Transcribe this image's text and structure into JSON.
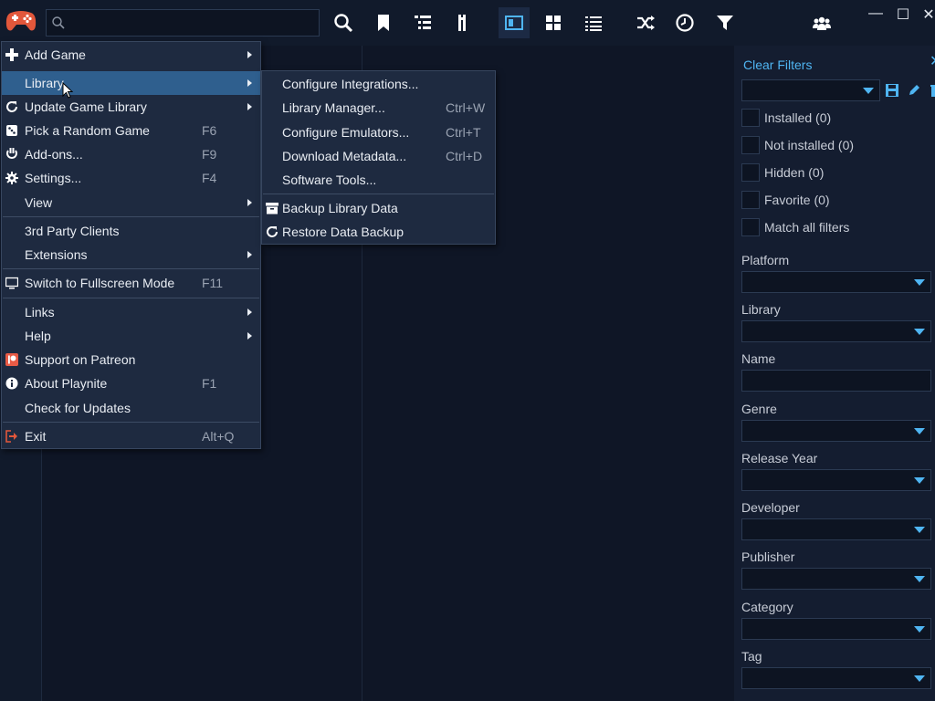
{
  "search": {
    "placeholder": ""
  },
  "toolbar": {
    "icons": [
      "search-icon",
      "bookmark-icon",
      "list-tree-icon",
      "columns-icon",
      "details-view-icon",
      "grid-view-icon",
      "list-view-icon",
      "shuffle-icon",
      "clock-icon",
      "filter-icon",
      "group-icon"
    ],
    "accent": "#4fb5f2"
  },
  "window": {
    "minimize": "—",
    "maximize": "☐",
    "close": "✕"
  },
  "main_menu": {
    "items": [
      {
        "label": "Add Game",
        "shortcut": "",
        "submenu": true,
        "icon": "plus-icon"
      },
      {
        "label": "Library",
        "shortcut": "",
        "submenu": true,
        "icon": ""
      },
      {
        "label": "Update Game Library",
        "shortcut": "",
        "submenu": true,
        "icon": "refresh-icon"
      },
      {
        "label": "Pick a Random Game",
        "shortcut": "F6",
        "submenu": false,
        "icon": "dice-icon"
      },
      {
        "label": "Add-ons...",
        "shortcut": "F9",
        "submenu": false,
        "icon": "plug-icon"
      },
      {
        "label": "Settings...",
        "shortcut": "F4",
        "submenu": false,
        "icon": "gear-icon"
      },
      {
        "label": "View",
        "shortcut": "",
        "submenu": true,
        "icon": ""
      },
      {
        "label": "3rd Party Clients",
        "shortcut": "",
        "submenu": false,
        "icon": ""
      },
      {
        "label": "Extensions",
        "shortcut": "",
        "submenu": true,
        "icon": ""
      },
      {
        "label": "Switch to Fullscreen Mode",
        "shortcut": "F11",
        "submenu": false,
        "icon": "monitor-icon"
      },
      {
        "label": "Links",
        "shortcut": "",
        "submenu": true,
        "icon": ""
      },
      {
        "label": "Help",
        "shortcut": "",
        "submenu": true,
        "icon": ""
      },
      {
        "label": "Support on Patreon",
        "shortcut": "",
        "submenu": false,
        "icon": "patreon-icon"
      },
      {
        "label": "About Playnite",
        "shortcut": "F1",
        "submenu": false,
        "icon": "info-icon"
      },
      {
        "label": "Check for Updates",
        "shortcut": "",
        "submenu": false,
        "icon": ""
      },
      {
        "label": "Exit",
        "shortcut": "Alt+Q",
        "submenu": false,
        "icon": "exit-icon"
      }
    ]
  },
  "library_menu": {
    "items": [
      {
        "label": "Configure Integrations...",
        "shortcut": ""
      },
      {
        "label": "Library Manager...",
        "shortcut": "Ctrl+W"
      },
      {
        "label": "Configure Emulators...",
        "shortcut": "Ctrl+T"
      },
      {
        "label": "Download Metadata...",
        "shortcut": "Ctrl+D"
      },
      {
        "label": "Software Tools...",
        "shortcut": ""
      },
      {
        "label": "Backup Library Data",
        "shortcut": "",
        "icon": "archive-icon"
      },
      {
        "label": "Restore Data Backup",
        "shortcut": "",
        "icon": "refresh-icon"
      }
    ]
  },
  "filter_panel": {
    "clear_filters": "Clear Filters",
    "checkboxes": [
      "Installed (0)",
      "Not installed (0)",
      "Hidden (0)",
      "Favorite (0)",
      "Match all filters"
    ],
    "fields": [
      "Platform",
      "Library",
      "Name",
      "Genre",
      "Release Year",
      "Developer",
      "Publisher",
      "Category",
      "Tag"
    ]
  }
}
